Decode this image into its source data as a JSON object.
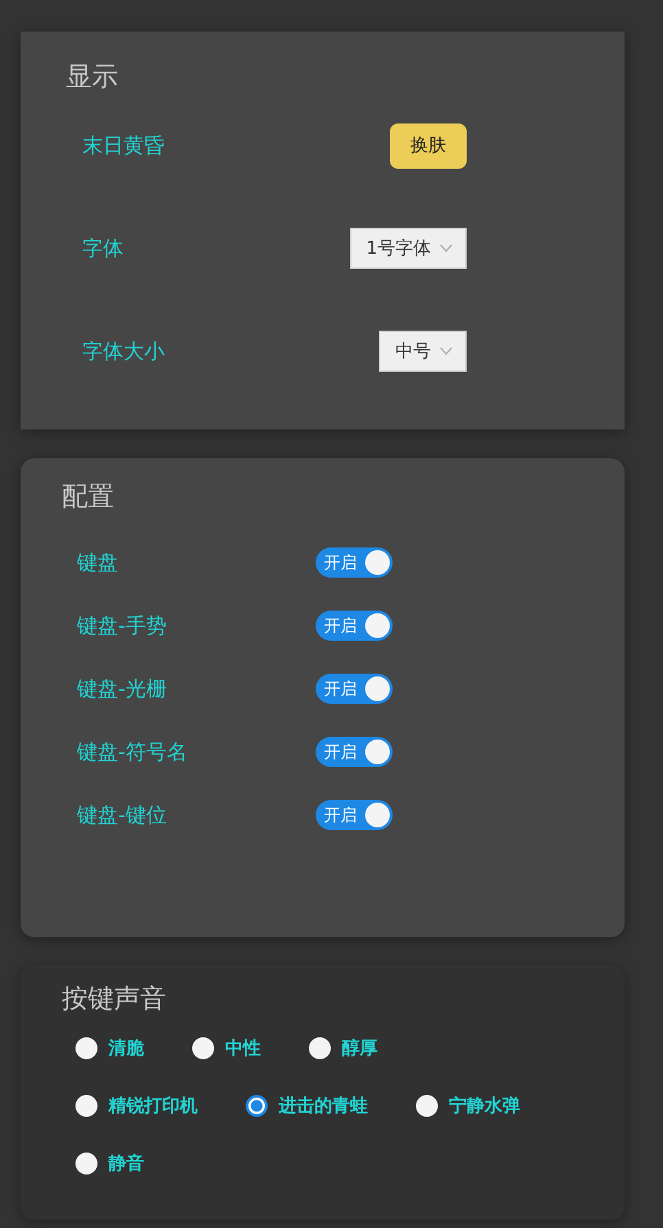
{
  "display": {
    "title": "显示",
    "rows": [
      {
        "kind": "button",
        "label": "末日黄昏",
        "button": "换肤"
      },
      {
        "kind": "select",
        "label": "字体",
        "value": "1号字体"
      },
      {
        "kind": "select",
        "label": "字体大小",
        "value": "中号"
      }
    ]
  },
  "config": {
    "title": "配置",
    "items": [
      {
        "label": "键盘",
        "toggle_text": "开启",
        "on": true
      },
      {
        "label": "键盘-手势",
        "toggle_text": "开启",
        "on": true
      },
      {
        "label": "键盘-光栅",
        "toggle_text": "开启",
        "on": true
      },
      {
        "label": "键盘-符号名",
        "toggle_text": "开启",
        "on": true
      },
      {
        "label": "键盘-键位",
        "toggle_text": "开启",
        "on": true
      }
    ]
  },
  "key_sound": {
    "title": "按键声音",
    "options": [
      {
        "label": "清脆",
        "selected": false
      },
      {
        "label": "中性",
        "selected": false
      },
      {
        "label": "醇厚",
        "selected": false
      },
      {
        "label": "精锐打印机",
        "selected": false
      },
      {
        "label": "进击的青蛙",
        "selected": true
      },
      {
        "label": "宁静水弹",
        "selected": false
      },
      {
        "label": "静音",
        "selected": false
      }
    ]
  }
}
